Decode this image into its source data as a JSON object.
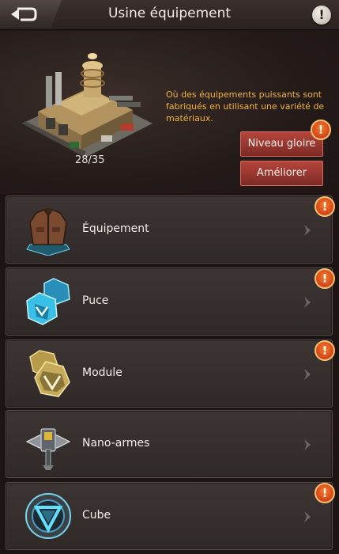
{
  "header": {
    "title": "Usine équipement",
    "info_label": "!"
  },
  "building": {
    "level_text": "28/35",
    "description": "Où des équipements puissants sont fabriqués en utilisant une variété de matériaux."
  },
  "buttons": {
    "gloire": "Niveau gloire",
    "ameliorer": "Améliorer"
  },
  "alert_mark": "!",
  "menu": {
    "items": [
      {
        "label": "Équipement",
        "icon": "jacket-icon",
        "alert": true
      },
      {
        "label": "Puce",
        "icon": "chip-icon",
        "alert": true
      },
      {
        "label": "Module",
        "icon": "module-icon",
        "alert": true
      },
      {
        "label": "Nano-armes",
        "icon": "hammer-icon",
        "alert": false
      },
      {
        "label": "Cube",
        "icon": "cube-icon",
        "alert": true
      }
    ]
  },
  "colors": {
    "accent_gold": "#f0b43a",
    "button_red": "#9a3631",
    "alert_orange": "#e1501e"
  }
}
